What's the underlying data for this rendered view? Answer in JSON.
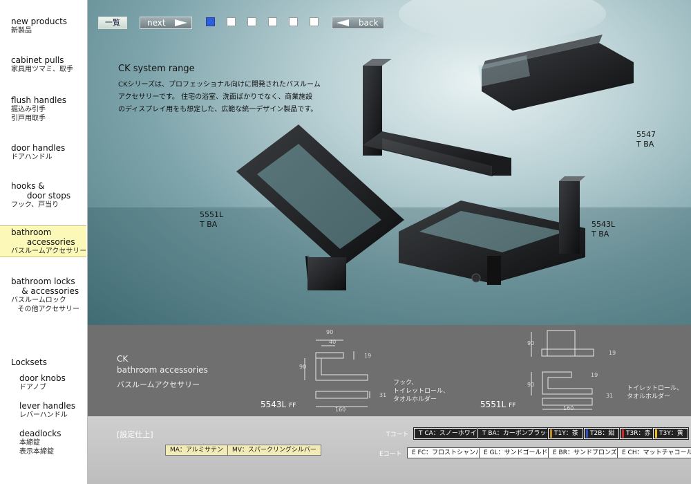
{
  "sidebar": {
    "items": [
      {
        "en": "new products",
        "jp": "新製品"
      },
      {
        "en": "cabinet pulls",
        "jp": "家具用ツマミ、取手"
      },
      {
        "en": "flush handles",
        "jp": "掘込み引手\n引戸用取手"
      },
      {
        "en": "door handles",
        "jp": "ドアハンドル"
      },
      {
        "en": "hooks &\n      door stops",
        "jp": "フック、戸当り"
      },
      {
        "en": "bathroom\n      accessories",
        "jp": "バスルームアクセサリー"
      },
      {
        "en": "bathroom locks\n    & accessories",
        "jp": "バスルームロック\n   その他アクセサリー"
      }
    ],
    "locksets_title": "Locksets",
    "locksets": [
      {
        "en": "door knobs",
        "jp": "ドアノブ"
      },
      {
        "en": "lever handles",
        "jp": "レバーハンドル"
      },
      {
        "en": "deadlocks",
        "jp": "本締錠\n表示本締錠"
      }
    ]
  },
  "topbar": {
    "list_label": "一覧",
    "next_label": "next",
    "back_label": "back",
    "pages": 6,
    "active_page": 1
  },
  "hero": {
    "title": "CK system range",
    "description": "CKシリーズは、プロフェッショナル向けに開発されたバスルーム\nアクセサリーです。 住宅の浴室、洗面ばかりでなく、商業施設\nのディスプレイ用をも想定した、広範な統一デザイン製品です。",
    "products": [
      {
        "code": "5547",
        "finish": "T BA"
      },
      {
        "code": "5551L",
        "finish": "T BA"
      },
      {
        "code": "5543L",
        "finish": "T BA"
      }
    ]
  },
  "info": {
    "line1": "CK",
    "line2": "bathroom accessories",
    "line3": "バスルームアクセサリー",
    "left_model": "5543L",
    "left_model_suffix": "FF",
    "right_model": "5551L",
    "right_model_suffix": "FF",
    "left_desc": "フック、\nトイレットロール、\nタオルホルダー",
    "right_desc": "トイレットロール、\nタオルホルダー",
    "dims_left": {
      "w90": "90",
      "w40": "40",
      "h90": "90",
      "d19": "19",
      "d31": "31",
      "w160": "160"
    },
    "dims_right": {
      "h90a": "90",
      "h90b": "90",
      "d19a": "19",
      "d19b": "19",
      "d31": "31",
      "w160": "160"
    }
  },
  "finish": {
    "label": "[設定仕上]",
    "ma": "MA：アルミサテン",
    "mv": "MV：スパークリングシルバー",
    "t_label": "Tコート",
    "e_label": "Eコート",
    "t_chips": [
      "T CA：スノーホワイト",
      "T BA：カーボンブラック"
    ],
    "t_color_chips": [
      {
        "text": "T1Y：茶",
        "color": "#c98a2a"
      },
      {
        "text": "T2B：紺",
        "color": "#3050c0"
      },
      {
        "text": "T3R：赤",
        "color": "#d02828"
      },
      {
        "text": "T3Y：黄",
        "color": "#e8c21a"
      }
    ],
    "e_chips": [
      "E FC：フロストシャンパン",
      "E GL：サンドゴールド",
      "E BR：サンドブロンズ",
      "E CH：マットチャコール"
    ]
  }
}
